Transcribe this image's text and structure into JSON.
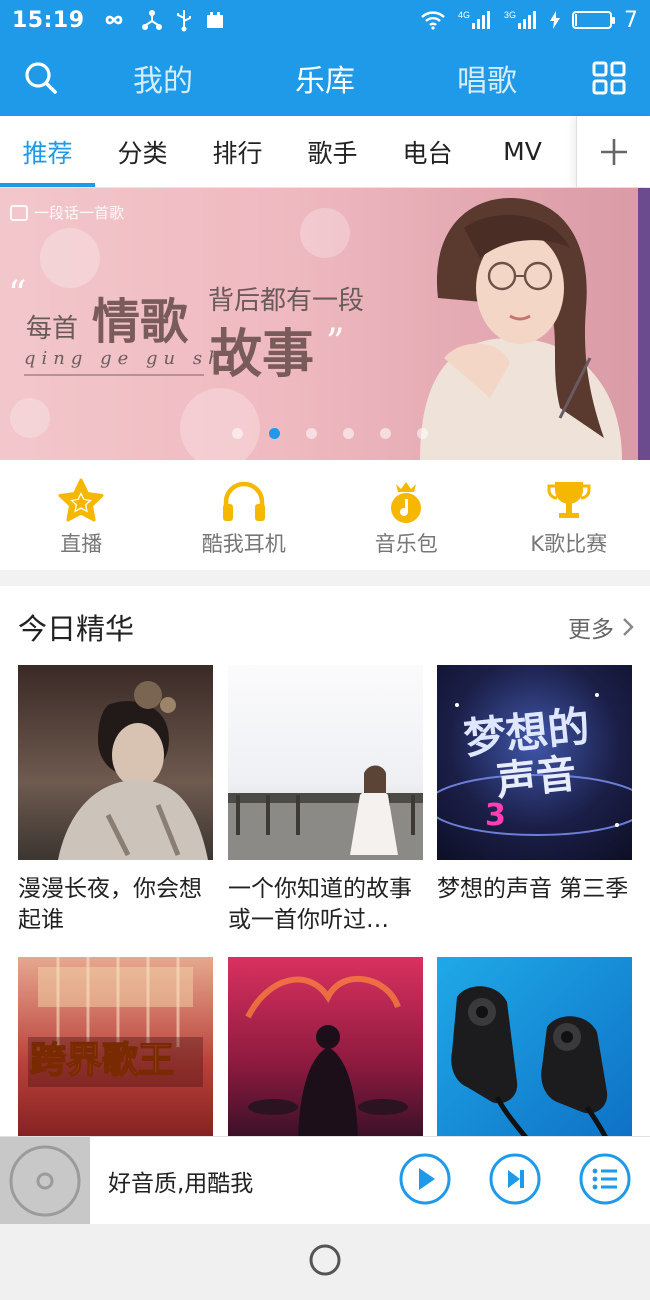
{
  "status_bar": {
    "time": "15:19",
    "network_labels": [
      "4G",
      "3G"
    ],
    "battery_level": 7,
    "battery_text": "7"
  },
  "appbar": {
    "tabs": [
      {
        "label": "我的",
        "active": false
      },
      {
        "label": "乐库",
        "active": true
      },
      {
        "label": "唱歌",
        "active": false
      }
    ]
  },
  "subnav": {
    "items": [
      "推荐",
      "分类",
      "排行",
      "歌手",
      "电台",
      "MV"
    ],
    "active_index": 0
  },
  "banner": {
    "tag": "一段话一首歌",
    "line_prefix": "每首",
    "line_big1": "情歌",
    "line_suffix": "背后都有一段",
    "pinyin": "qing ge gu shi",
    "line_big2": "故事",
    "open_quote": "“",
    "close_quote": "”",
    "dot_count": 6,
    "active_dot": 1
  },
  "quick_entries": [
    {
      "label": "直播",
      "icon": "star-icon"
    },
    {
      "label": "酷我耳机",
      "icon": "headphones-icon"
    },
    {
      "label": "音乐包",
      "icon": "music-bag-icon"
    },
    {
      "label": "K歌比赛",
      "icon": "trophy-icon"
    }
  ],
  "today": {
    "title": "今日精华",
    "more": "更多",
    "cards": [
      {
        "caption": "漫漫长夜，你会想起谁"
      },
      {
        "caption": "一个你知道的故事或一首你听过…"
      },
      {
        "caption": "梦想的声音 第三季"
      },
      {
        "caption": ""
      },
      {
        "caption": ""
      },
      {
        "caption": ""
      }
    ]
  },
  "player": {
    "title": "好音质,用酷我"
  },
  "colors": {
    "accent": "#1e9ae8",
    "gold": "#f5b700"
  }
}
